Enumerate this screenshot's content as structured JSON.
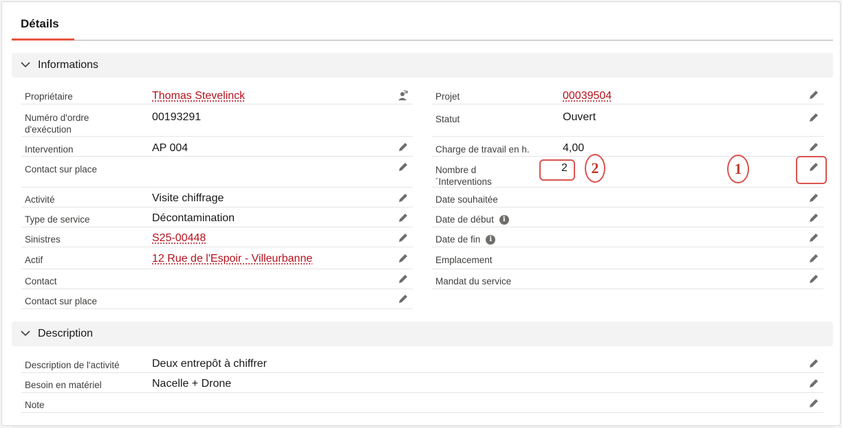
{
  "tabs": {
    "details_label": "Détails"
  },
  "informations": {
    "title": "Informations",
    "left": [
      {
        "label": "Propriétaire",
        "value": "Thomas Stevelinck",
        "link": true,
        "action": "change-owner-icon"
      },
      {
        "label": "Numéro d'ordre d'exécution",
        "value": "00193291",
        "link": false,
        "action": ""
      },
      {
        "label": "Intervention",
        "value": "AP 004",
        "link": false,
        "action": "edit-icon"
      },
      {
        "label": "Contact sur place",
        "value": "",
        "link": false,
        "action": "edit-icon"
      },
      {
        "label": "Activité",
        "value": "Visite chiffrage",
        "link": false,
        "action": "edit-icon"
      },
      {
        "label": "Type de service",
        "value": "Décontamination",
        "link": false,
        "action": "edit-icon"
      },
      {
        "label": "Sinistres",
        "value": "S25-00448",
        "link": true,
        "action": "edit-icon"
      },
      {
        "label": "Actif",
        "value": "12 Rue de l'Espoir - Villeurbanne",
        "link": true,
        "action": "edit-icon"
      },
      {
        "label": "Contact",
        "value": "",
        "link": false,
        "action": "edit-icon"
      },
      {
        "label": "Contact sur place",
        "value": "",
        "link": false,
        "action": "edit-icon"
      }
    ],
    "right": [
      {
        "label": "Projet",
        "value": "00039504",
        "link": true,
        "action": "edit-icon"
      },
      {
        "label": "Statut",
        "value": "Ouvert",
        "link": false,
        "action": "edit-icon"
      },
      {
        "label": "Charge de travail en h.",
        "value": "4,00",
        "link": false,
        "action": "edit-icon"
      },
      {
        "label": "Nombre d ´Interventions",
        "value": "2",
        "link": false,
        "action": "edit-icon"
      },
      {
        "label": "Date souhaitée",
        "value": "",
        "link": false,
        "action": "edit-icon"
      },
      {
        "label": "Date de début",
        "value": "",
        "link": false,
        "action": "edit-icon",
        "info": "i"
      },
      {
        "label": "Date de fin",
        "value": "",
        "link": false,
        "action": "edit-icon",
        "info": "i"
      },
      {
        "label": "Emplacement",
        "value": "",
        "link": false,
        "action": "edit-icon"
      },
      {
        "label": "Mandat du service",
        "value": "",
        "link": false,
        "action": "edit-icon"
      }
    ]
  },
  "description": {
    "title": "Description",
    "rows": [
      {
        "label": "Description de l'activité",
        "value": "Deux entrepôt à chiffrer"
      },
      {
        "label": "Besoin en matériel",
        "value": "Nacelle + Drone"
      },
      {
        "label": "Note",
        "value": ""
      }
    ]
  },
  "annotations": {
    "marker_1": "1",
    "marker_2": "2"
  },
  "colors": {
    "accent": "#e8533f",
    "link": "#b5111b",
    "annotation": "#d9534f"
  }
}
